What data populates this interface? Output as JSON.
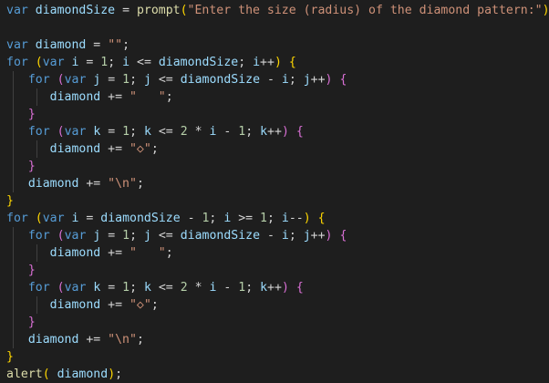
{
  "editor": {
    "theme": {
      "background": "#1e1e1e",
      "keyword": "#569cd6",
      "variable": "#9cdcfe",
      "function": "#dcdcaa",
      "string": "#ce9178",
      "number": "#b5cea8",
      "operator": "#d4d4d4",
      "bracket_level1": "#ffd700",
      "bracket_level2": "#da70d6",
      "bracket_level3": "#179fff"
    },
    "lines": [
      {
        "tokens": [
          {
            "t": "var",
            "c": "kw"
          },
          {
            "t": " "
          },
          {
            "t": "diamondSize",
            "c": "var"
          },
          {
            "t": " = ",
            "c": "op"
          },
          {
            "t": "prompt",
            "c": "fn"
          },
          {
            "t": "(",
            "c": "br1"
          },
          {
            "t": "\"Enter the size (radius) of the diamond pattern:\"",
            "c": "str"
          },
          {
            "t": ")",
            "c": "br1"
          },
          {
            "t": ";",
            "c": "op"
          }
        ]
      },
      {
        "tokens": []
      },
      {
        "tokens": [
          {
            "t": "var",
            "c": "kw"
          },
          {
            "t": " "
          },
          {
            "t": "diamond",
            "c": "var"
          },
          {
            "t": " = ",
            "c": "op"
          },
          {
            "t": "\"\"",
            "c": "str"
          },
          {
            "t": ";",
            "c": "op"
          }
        ]
      },
      {
        "tokens": [
          {
            "t": "for",
            "c": "kw"
          },
          {
            "t": " "
          },
          {
            "t": "(",
            "c": "br1"
          },
          {
            "t": "var",
            "c": "kw"
          },
          {
            "t": " "
          },
          {
            "t": "i",
            "c": "var"
          },
          {
            "t": " = ",
            "c": "op"
          },
          {
            "t": "1",
            "c": "num"
          },
          {
            "t": "; ",
            "c": "op"
          },
          {
            "t": "i",
            "c": "var"
          },
          {
            "t": " <= ",
            "c": "op"
          },
          {
            "t": "diamondSize",
            "c": "var"
          },
          {
            "t": "; ",
            "c": "op"
          },
          {
            "t": "i",
            "c": "var"
          },
          {
            "t": "++",
            "c": "op"
          },
          {
            "t": ")",
            "c": "br1"
          },
          {
            "t": " "
          },
          {
            "t": "{",
            "c": "br1"
          }
        ]
      },
      {
        "tokens": [
          {
            "t": "   "
          },
          {
            "t": "for",
            "c": "kw"
          },
          {
            "t": " "
          },
          {
            "t": "(",
            "c": "br2"
          },
          {
            "t": "var",
            "c": "kw"
          },
          {
            "t": " "
          },
          {
            "t": "j",
            "c": "var"
          },
          {
            "t": " = ",
            "c": "op"
          },
          {
            "t": "1",
            "c": "num"
          },
          {
            "t": "; ",
            "c": "op"
          },
          {
            "t": "j",
            "c": "var"
          },
          {
            "t": " <= ",
            "c": "op"
          },
          {
            "t": "diamondSize",
            "c": "var"
          },
          {
            "t": " - ",
            "c": "op"
          },
          {
            "t": "i",
            "c": "var"
          },
          {
            "t": "; ",
            "c": "op"
          },
          {
            "t": "j",
            "c": "var"
          },
          {
            "t": "++",
            "c": "op"
          },
          {
            "t": ")",
            "c": "br2"
          },
          {
            "t": " "
          },
          {
            "t": "{",
            "c": "br2"
          }
        ]
      },
      {
        "tokens": [
          {
            "t": "      "
          },
          {
            "t": "diamond",
            "c": "var"
          },
          {
            "t": " += ",
            "c": "op"
          },
          {
            "t": "\"   \"",
            "c": "str"
          },
          {
            "t": ";",
            "c": "op"
          }
        ]
      },
      {
        "tokens": [
          {
            "t": "   "
          },
          {
            "t": "}",
            "c": "br2"
          }
        ]
      },
      {
        "tokens": [
          {
            "t": "   "
          },
          {
            "t": "for",
            "c": "kw"
          },
          {
            "t": " "
          },
          {
            "t": "(",
            "c": "br2"
          },
          {
            "t": "var",
            "c": "kw"
          },
          {
            "t": " "
          },
          {
            "t": "k",
            "c": "var"
          },
          {
            "t": " = ",
            "c": "op"
          },
          {
            "t": "1",
            "c": "num"
          },
          {
            "t": "; ",
            "c": "op"
          },
          {
            "t": "k",
            "c": "var"
          },
          {
            "t": " <= ",
            "c": "op"
          },
          {
            "t": "2",
            "c": "num"
          },
          {
            "t": " * ",
            "c": "op"
          },
          {
            "t": "i",
            "c": "var"
          },
          {
            "t": " - ",
            "c": "op"
          },
          {
            "t": "1",
            "c": "num"
          },
          {
            "t": "; ",
            "c": "op"
          },
          {
            "t": "k",
            "c": "var"
          },
          {
            "t": "++",
            "c": "op"
          },
          {
            "t": ")",
            "c": "br2"
          },
          {
            "t": " "
          },
          {
            "t": "{",
            "c": "br2"
          }
        ]
      },
      {
        "tokens": [
          {
            "t": "      "
          },
          {
            "t": "diamond",
            "c": "var"
          },
          {
            "t": " += ",
            "c": "op"
          },
          {
            "t": "\"◇\"",
            "c": "str"
          },
          {
            "t": ";",
            "c": "op"
          }
        ]
      },
      {
        "tokens": [
          {
            "t": "   "
          },
          {
            "t": "}",
            "c": "br2"
          }
        ]
      },
      {
        "tokens": [
          {
            "t": "   "
          },
          {
            "t": "diamond",
            "c": "var"
          },
          {
            "t": " += ",
            "c": "op"
          },
          {
            "t": "\"\\n\"",
            "c": "str"
          },
          {
            "t": ";",
            "c": "op"
          }
        ]
      },
      {
        "tokens": [
          {
            "t": "}",
            "c": "br1"
          }
        ]
      },
      {
        "tokens": [
          {
            "t": "for",
            "c": "kw"
          },
          {
            "t": " "
          },
          {
            "t": "(",
            "c": "br1"
          },
          {
            "t": "var",
            "c": "kw"
          },
          {
            "t": " "
          },
          {
            "t": "i",
            "c": "var"
          },
          {
            "t": " = ",
            "c": "op"
          },
          {
            "t": "diamondSize",
            "c": "var"
          },
          {
            "t": " - ",
            "c": "op"
          },
          {
            "t": "1",
            "c": "num"
          },
          {
            "t": "; ",
            "c": "op"
          },
          {
            "t": "i",
            "c": "var"
          },
          {
            "t": " >= ",
            "c": "op"
          },
          {
            "t": "1",
            "c": "num"
          },
          {
            "t": "; ",
            "c": "op"
          },
          {
            "t": "i",
            "c": "var"
          },
          {
            "t": "--",
            "c": "op"
          },
          {
            "t": ")",
            "c": "br1"
          },
          {
            "t": " "
          },
          {
            "t": "{",
            "c": "br1"
          }
        ]
      },
      {
        "tokens": [
          {
            "t": "   "
          },
          {
            "t": "for",
            "c": "kw"
          },
          {
            "t": " "
          },
          {
            "t": "(",
            "c": "br2"
          },
          {
            "t": "var",
            "c": "kw"
          },
          {
            "t": " "
          },
          {
            "t": "j",
            "c": "var"
          },
          {
            "t": " = ",
            "c": "op"
          },
          {
            "t": "1",
            "c": "num"
          },
          {
            "t": "; ",
            "c": "op"
          },
          {
            "t": "j",
            "c": "var"
          },
          {
            "t": " <= ",
            "c": "op"
          },
          {
            "t": "diamondSize",
            "c": "var"
          },
          {
            "t": " - ",
            "c": "op"
          },
          {
            "t": "i",
            "c": "var"
          },
          {
            "t": "; ",
            "c": "op"
          },
          {
            "t": "j",
            "c": "var"
          },
          {
            "t": "++",
            "c": "op"
          },
          {
            "t": ")",
            "c": "br2"
          },
          {
            "t": " "
          },
          {
            "t": "{",
            "c": "br2"
          }
        ]
      },
      {
        "tokens": [
          {
            "t": "      "
          },
          {
            "t": "diamond",
            "c": "var"
          },
          {
            "t": " += ",
            "c": "op"
          },
          {
            "t": "\"   \"",
            "c": "str"
          },
          {
            "t": ";",
            "c": "op"
          }
        ]
      },
      {
        "tokens": [
          {
            "t": "   "
          },
          {
            "t": "}",
            "c": "br2"
          }
        ]
      },
      {
        "tokens": [
          {
            "t": "   "
          },
          {
            "t": "for",
            "c": "kw"
          },
          {
            "t": " "
          },
          {
            "t": "(",
            "c": "br2"
          },
          {
            "t": "var",
            "c": "kw"
          },
          {
            "t": " "
          },
          {
            "t": "k",
            "c": "var"
          },
          {
            "t": " = ",
            "c": "op"
          },
          {
            "t": "1",
            "c": "num"
          },
          {
            "t": "; ",
            "c": "op"
          },
          {
            "t": "k",
            "c": "var"
          },
          {
            "t": " <= ",
            "c": "op"
          },
          {
            "t": "2",
            "c": "num"
          },
          {
            "t": " * ",
            "c": "op"
          },
          {
            "t": "i",
            "c": "var"
          },
          {
            "t": " - ",
            "c": "op"
          },
          {
            "t": "1",
            "c": "num"
          },
          {
            "t": "; ",
            "c": "op"
          },
          {
            "t": "k",
            "c": "var"
          },
          {
            "t": "++",
            "c": "op"
          },
          {
            "t": ")",
            "c": "br2"
          },
          {
            "t": " "
          },
          {
            "t": "{",
            "c": "br2"
          }
        ]
      },
      {
        "tokens": [
          {
            "t": "      "
          },
          {
            "t": "diamond",
            "c": "var"
          },
          {
            "t": " += ",
            "c": "op"
          },
          {
            "t": "\"◇\"",
            "c": "str"
          },
          {
            "t": ";",
            "c": "op"
          }
        ]
      },
      {
        "tokens": [
          {
            "t": "   "
          },
          {
            "t": "}",
            "c": "br2"
          }
        ]
      },
      {
        "tokens": [
          {
            "t": "   "
          },
          {
            "t": "diamond",
            "c": "var"
          },
          {
            "t": " += ",
            "c": "op"
          },
          {
            "t": "\"\\n\"",
            "c": "str"
          },
          {
            "t": ";",
            "c": "op"
          }
        ]
      },
      {
        "tokens": [
          {
            "t": "}",
            "c": "br1"
          }
        ]
      },
      {
        "tokens": [
          {
            "t": "alert",
            "c": "fn"
          },
          {
            "t": "(",
            "c": "br1"
          },
          {
            "t": " "
          },
          {
            "t": "diamond",
            "c": "var"
          },
          {
            "t": ")",
            "c": "br1"
          },
          {
            "t": ";",
            "c": "op"
          }
        ]
      }
    ]
  }
}
